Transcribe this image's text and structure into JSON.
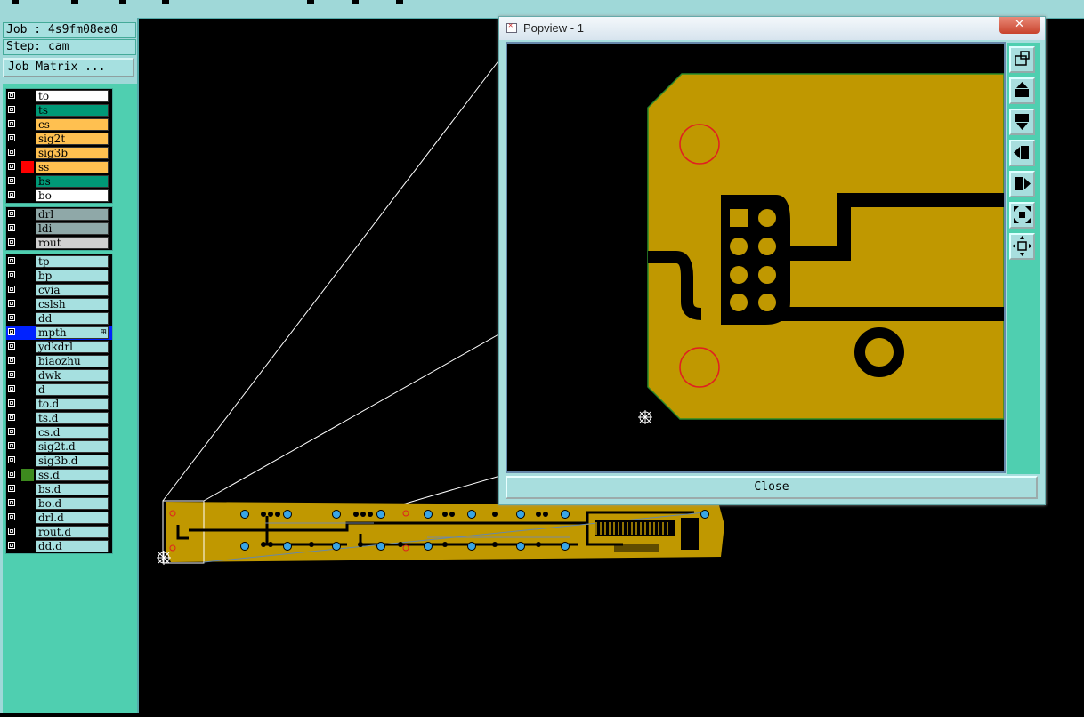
{
  "job": {
    "label": "Job : 4s9fm08ea0",
    "step": "Step: cam",
    "matrix_button": "Job Matrix ..."
  },
  "layer_groups": [
    [
      {
        "name": "to",
        "color": "#ffffff",
        "swatch": "#000000"
      },
      {
        "name": "ts",
        "color": "#009977",
        "swatch": "#000000"
      },
      {
        "name": "cs",
        "color": "#ffc050",
        "swatch": "#000000"
      },
      {
        "name": "sig2t",
        "color": "#ffc050",
        "swatch": "#000000"
      },
      {
        "name": "sig3b",
        "color": "#ffc050",
        "swatch": "#000000"
      },
      {
        "name": "ss",
        "color": "#ffc050",
        "swatch": "#ff0000"
      },
      {
        "name": "bs",
        "color": "#009977",
        "swatch": "#000000"
      },
      {
        "name": "bo",
        "color": "#ffffff",
        "swatch": "#000000"
      }
    ],
    [
      {
        "name": "drl",
        "color": "#8fa8a8",
        "swatch": "#000000"
      },
      {
        "name": "ldi",
        "color": "#8fa8a8",
        "swatch": "#000000"
      },
      {
        "name": "rout",
        "color": "#d0d0d0",
        "swatch": "#000000"
      }
    ],
    [
      {
        "name": "tp",
        "color": "#a6e0e0",
        "swatch": "#000000"
      },
      {
        "name": "bp",
        "color": "#a6e0e0",
        "swatch": "#000000"
      },
      {
        "name": "cvia",
        "color": "#a6e0e0",
        "swatch": "#000000"
      },
      {
        "name": "cslsh",
        "color": "#a6e0e0",
        "swatch": "#000000"
      },
      {
        "name": "dd",
        "color": "#a6e0e0",
        "swatch": "#000000"
      },
      {
        "name": "mpth",
        "color": "#a6e0e0",
        "swatch": "#0022ff",
        "selected": true,
        "marker": "⊞"
      },
      {
        "name": "ydkdrl",
        "color": "#a6e0e0",
        "swatch": "#000000"
      },
      {
        "name": "biaozhu",
        "color": "#a6e0e0",
        "swatch": "#000000"
      },
      {
        "name": "dwk",
        "color": "#a6e0e0",
        "swatch": "#000000"
      },
      {
        "name": "d",
        "color": "#a6e0e0",
        "swatch": "#000000"
      },
      {
        "name": "to.d",
        "color": "#a6e0e0",
        "swatch": "#000000"
      },
      {
        "name": "ts.d",
        "color": "#a6e0e0",
        "swatch": "#000000"
      },
      {
        "name": "cs.d",
        "color": "#a6e0e0",
        "swatch": "#000000"
      },
      {
        "name": "sig2t.d",
        "color": "#a6e0e0",
        "swatch": "#000000"
      },
      {
        "name": "sig3b.d",
        "color": "#a6e0e0",
        "swatch": "#000000"
      },
      {
        "name": "ss.d",
        "color": "#a6e0e0",
        "swatch": "#3d8a1e"
      },
      {
        "name": "bs.d",
        "color": "#a6e0e0",
        "swatch": "#000000"
      },
      {
        "name": "bo.d",
        "color": "#a6e0e0",
        "swatch": "#000000"
      },
      {
        "name": "drl.d",
        "color": "#a6e0e0",
        "swatch": "#000000"
      },
      {
        "name": "rout.d",
        "color": "#a6e0e0",
        "swatch": "#000000"
      },
      {
        "name": "dd.d",
        "color": "#a6e0e0",
        "swatch": "#000000"
      }
    ]
  ],
  "popview": {
    "title": "Popview - 1",
    "close_x": "✕",
    "close_label": "Close",
    "tools": [
      "zoom-fit-icon",
      "pan-up-icon",
      "pan-down-icon",
      "pan-left-icon",
      "pan-right-icon",
      "zoom-in-icon",
      "zoom-out-icon"
    ]
  },
  "colors": {
    "board": "#c09800",
    "panel": "#9fd8d8",
    "toolbar": "#4fcfb0"
  }
}
